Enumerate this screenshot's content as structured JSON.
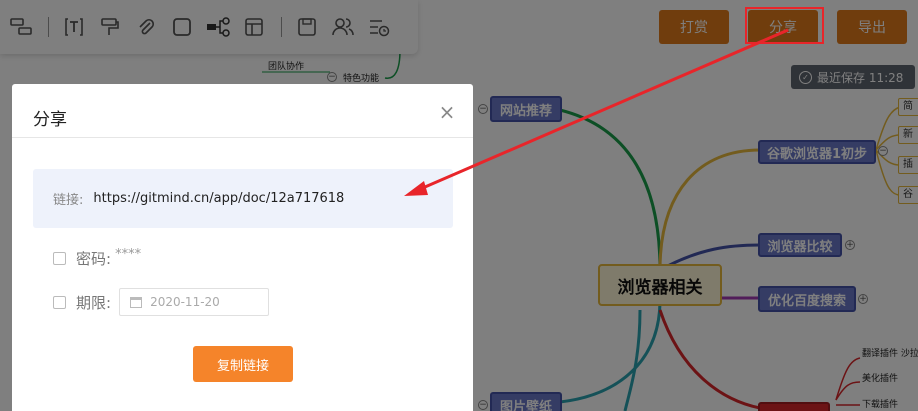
{
  "toolbar": {
    "icons": [
      "layout-icon",
      "text-icon",
      "format-painter-icon",
      "attachment-icon",
      "shape-icon",
      "structure-icon",
      "template-icon",
      "save-icon",
      "collaborate-icon",
      "history-icon"
    ]
  },
  "header_actions": {
    "reward_label": "打赏",
    "share_label": "分享",
    "export_label": "导出"
  },
  "save_status": "最近保存 11:28",
  "colors": {
    "accent_orange": "#e07b1a",
    "copy_button": "#f5842a",
    "highlight_red": "#e8252a",
    "link_box_bg": "#eef2fb",
    "node_blue": "#6b78c9"
  },
  "mindmap": {
    "center": "浏览器相关",
    "nodes": {
      "website": "网站推荐",
      "chrome": "谷歌浏览器1初步",
      "compare": "浏览器比较",
      "baidu": "优化百度搜索",
      "wallpaper": "图片壁纸",
      "team": "团队协作",
      "features": "特色功能",
      "translate": "翻译插件 沙拉",
      "beautify": "美化插件",
      "download": "下载插件"
    }
  },
  "dialog": {
    "title": "分享",
    "close_icon": "close-icon",
    "link_label": "链接:",
    "link_url": "https://gitmind.cn/app/doc/12a717618",
    "password_label": "密码:",
    "password_value": "****",
    "expiry_label": "期限:",
    "expiry_date": "2020-11-20",
    "copy_label": "复制链接"
  }
}
